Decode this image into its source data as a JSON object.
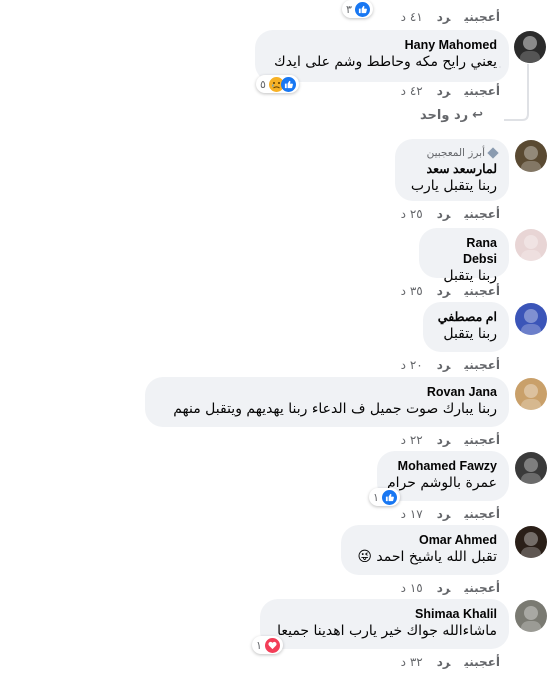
{
  "actions": {
    "like": "أعجبني",
    "reply": "رد"
  },
  "top": {
    "time": "٤١ د",
    "count": "٣"
  },
  "main_comment": {
    "name": "Hany Mahomed",
    "text": "يعني رايح مكه وحاطط وشم على ايدك",
    "time": "٤٢ د",
    "reaction_count": "٥",
    "reactions": [
      "like-icon",
      "sad-icon"
    ]
  },
  "reply_link": "رد واحد",
  "replies": [
    {
      "badge": "أبرز المعجبين",
      "name": "لمارسعد سعد",
      "text": "ربنا يتقبل يارب",
      "time": "٢٥ د",
      "avatar": "#5a4a32"
    },
    {
      "name": "Rana Debsi",
      "text": "ربنا يتقبل",
      "time": "٣٥ د",
      "avatar": "#e8d5d5"
    },
    {
      "name": "ام مصطفي",
      "text": "ربنا يتقبل",
      "time": "٢٠ د",
      "avatar": "#3b55b8"
    },
    {
      "name": "Rovan Jana",
      "text": "ربنا يبارك صوت جميل ف الدعاء ربنا يهديهم ويتقبل منهم",
      "time": "٢٢ د",
      "avatar": "#c9a06a"
    },
    {
      "name": "Mohamed Fawzy",
      "text": "عمرة بالوشم حرام",
      "time": "١٧ د",
      "avatar": "#3a3a3a",
      "reaction_count": "١",
      "reaction": "like-icon"
    },
    {
      "name": "Omar Ahmed",
      "text": "تقبل الله ياشيخ احمد 😜",
      "time": "١٥ د",
      "avatar": "#2a1f18"
    },
    {
      "name": "Shimaa Khalil",
      "text": "ماشاءالله جواك خير يارب اهدينا جميعا",
      "time": "٣٢ د",
      "avatar": "#7a7a72",
      "reaction_count": "١",
      "reaction": "heart-icon"
    }
  ],
  "colors": {
    "bubble": "#f0f2f5",
    "secondary_text": "#65676b",
    "like_blue": "#1877f2"
  }
}
